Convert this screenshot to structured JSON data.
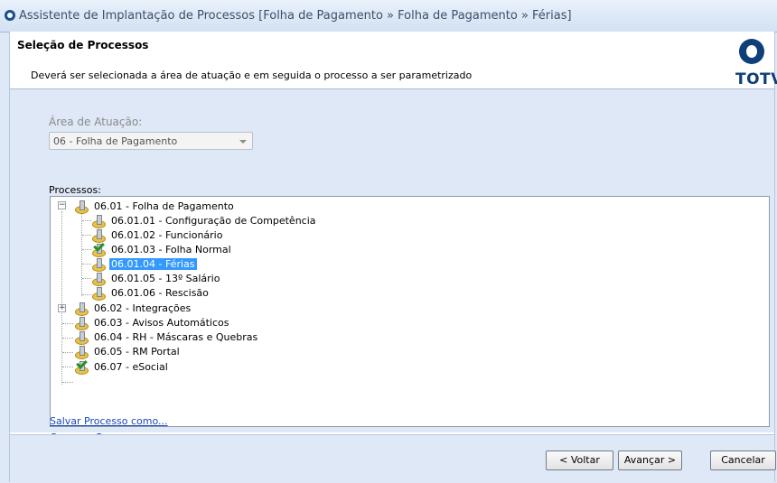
{
  "window": {
    "title": "Assistente de Implantação de Processos [Folha de Pagamento » Folha de Pagamento » Férias]"
  },
  "header": {
    "title": "Seleção de Processos",
    "subtitle": "Deverá ser selecionada a área de atuação e em seguida o processo a ser parametrizado",
    "logo_text": "TOTVS"
  },
  "area": {
    "label": "Área de Atuação:",
    "selected": "06 - Folha de Pagamento"
  },
  "processes": {
    "label": "Processos:",
    "items": [
      {
        "label": "06.01 - Folha de Pagamento",
        "expanded": true,
        "checked": false
      },
      {
        "label": "06.01.01 - Configuração de Competência",
        "checked": false
      },
      {
        "label": "06.01.02 - Funcionário",
        "checked": false
      },
      {
        "label": "06.01.03 - Folha Normal",
        "checked": true
      },
      {
        "label": "06.01.04 - Férias",
        "checked": false,
        "selected": true
      },
      {
        "label": "06.01.05 - 13º Salário",
        "checked": false
      },
      {
        "label": "06.01.06 - Rescisão",
        "checked": false
      },
      {
        "label": "06.02 - Integrações",
        "expanded": false,
        "checked": false
      },
      {
        "label": "06.03 - Avisos Automáticos",
        "checked": false
      },
      {
        "label": "06.04 - RH - Máscaras e Quebras",
        "checked": false
      },
      {
        "label": "06.05 - RM Portal",
        "checked": false
      },
      {
        "label": "06.07 - eSocial",
        "checked": true
      }
    ]
  },
  "links": {
    "load": "Carregar Processo...",
    "save": "Salvar Processo como..."
  },
  "buttons": {
    "back": "< Voltar",
    "next": "Avançar >",
    "cancel": "Cancelar"
  },
  "colors": {
    "selection": "#3399ff",
    "brand": "#0f3e78",
    "link": "#1a46b8"
  }
}
